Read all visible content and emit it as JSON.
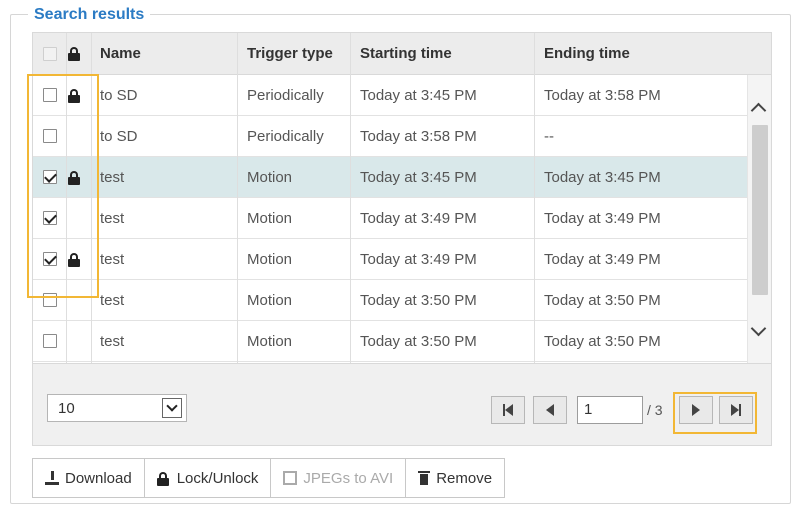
{
  "section": {
    "title": "Search results"
  },
  "columns": {
    "name": "Name",
    "trigger": "Trigger type",
    "start": "Starting time",
    "end": "Ending time"
  },
  "rows": [
    {
      "checked": false,
      "locked": true,
      "name": "to SD",
      "trigger": "Periodically",
      "start": "Today at 3:45 PM",
      "end": "Today at 3:58 PM",
      "selected": false
    },
    {
      "checked": false,
      "locked": false,
      "name": "to SD",
      "trigger": "Periodically",
      "start": "Today at 3:58 PM",
      "end": "--",
      "selected": false
    },
    {
      "checked": true,
      "locked": true,
      "name": "test",
      "trigger": "Motion",
      "start": "Today at 3:45 PM",
      "end": "Today at 3:45 PM",
      "selected": true
    },
    {
      "checked": true,
      "locked": false,
      "name": "test",
      "trigger": "Motion",
      "start": "Today at 3:49 PM",
      "end": "Today at 3:49 PM",
      "selected": false
    },
    {
      "checked": true,
      "locked": true,
      "name": "test",
      "trigger": "Motion",
      "start": "Today at 3:49 PM",
      "end": "Today at 3:49 PM",
      "selected": false
    },
    {
      "checked": false,
      "locked": false,
      "name": "test",
      "trigger": "Motion",
      "start": "Today at 3:50 PM",
      "end": "Today at 3:50 PM",
      "selected": false
    },
    {
      "checked": false,
      "locked": false,
      "name": "test",
      "trigger": "Motion",
      "start": "Today at 3:50 PM",
      "end": "Today at 3:50 PM",
      "selected": false
    }
  ],
  "pagination": {
    "per_page": "10",
    "current_page": "1",
    "total": "/ 3"
  },
  "actions": {
    "download": "Download",
    "lock": "Lock/Unlock",
    "jpegs": "JPEGs to AVI",
    "remove": "Remove"
  },
  "colors": {
    "accent": "#2b7bc4",
    "highlight": "#f2b735",
    "selected_row": "#d9e8ea"
  }
}
